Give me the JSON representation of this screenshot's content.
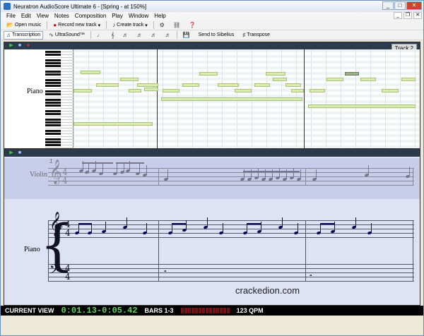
{
  "window": {
    "title": "Neuratron AudioScore Ultimate 6 - [Spring - at 150%]",
    "minimize": "_",
    "maximize": "□",
    "close": "✕"
  },
  "menu": [
    "File",
    "Edit",
    "View",
    "Notes",
    "Composition",
    "Play",
    "Window",
    "Help"
  ],
  "toolbar1": {
    "open": "Open music",
    "record": "Record new track",
    "create": "Create track"
  },
  "toolbar2": {
    "transcription": "Transcription",
    "ultrasound": "UltraSound™",
    "sibelius": "Send to Sibelius",
    "transpose": "Transpose"
  },
  "pianoroll": {
    "track_label": "Track 2",
    "instrument": "Piano"
  },
  "score": {
    "violin": "Violin",
    "piano": "Piano",
    "measure_number": "1"
  },
  "status": {
    "view_label": "CURRENT VIEW",
    "start": "0:01.13",
    "dash": "-",
    "end": "0:05.42",
    "bars": "BARS 1-3",
    "tempo": "123 QPM"
  },
  "watermark": "crackedion.com",
  "colors": {
    "accent": "#5fd45f",
    "note": "#d9ecb0"
  }
}
